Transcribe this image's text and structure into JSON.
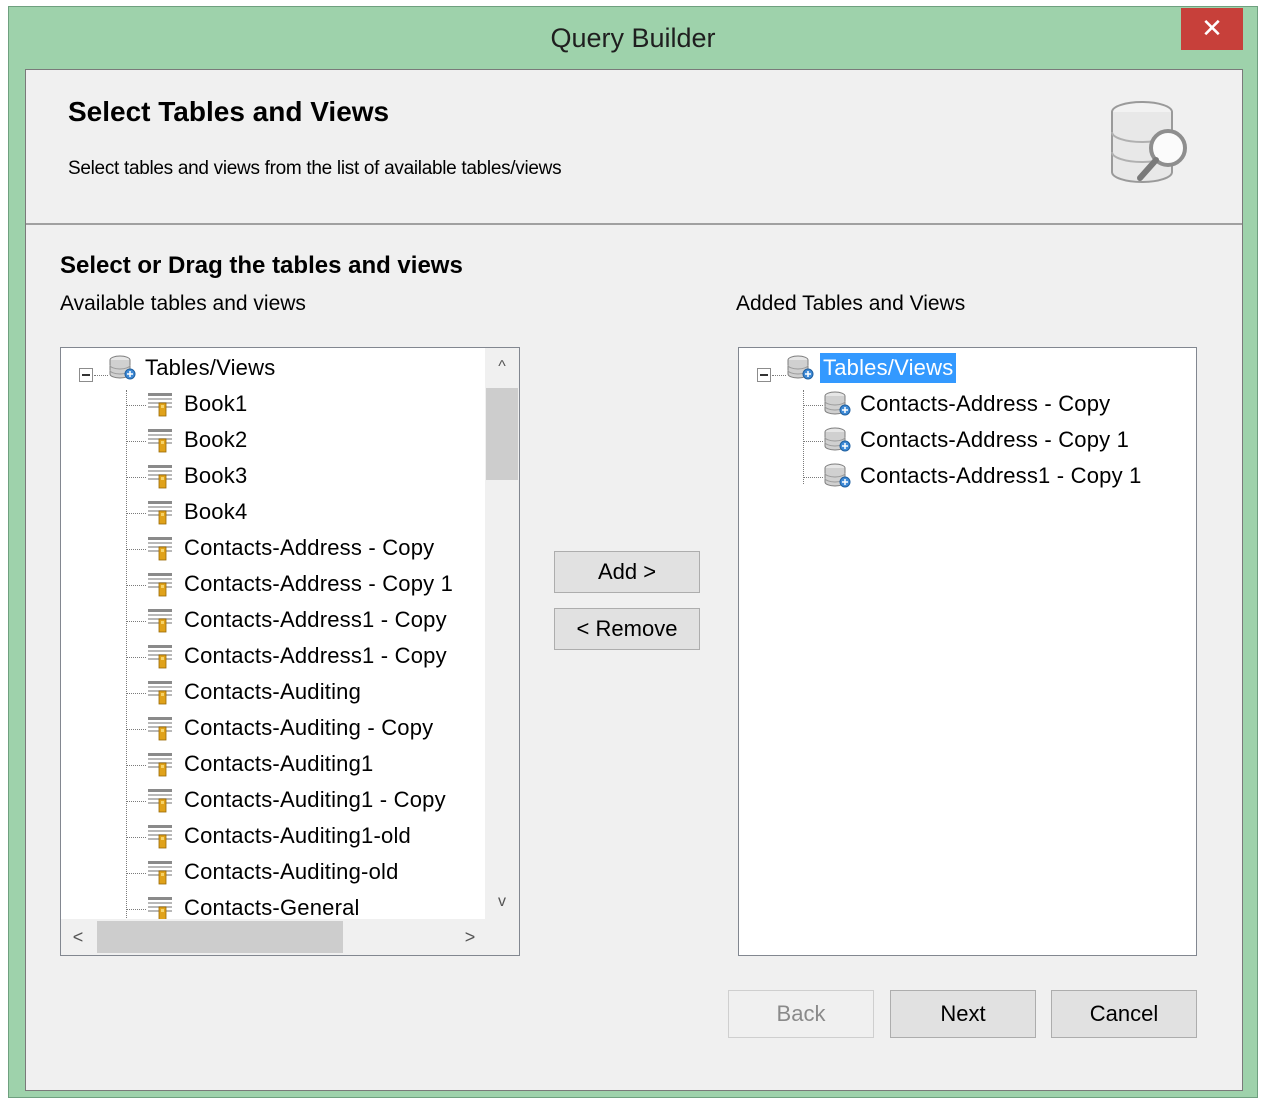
{
  "window": {
    "title": "Query Builder",
    "close_label": "✕"
  },
  "header": {
    "title": "Select Tables and Views",
    "subtitle": "Select tables and views from the list of available tables/views",
    "icon": "database-search-icon"
  },
  "section_title": "Select or Drag the tables and views",
  "available": {
    "label": "Available tables and views",
    "root": "Tables/Views",
    "items": [
      "Book1",
      "Book2",
      "Book3",
      "Book4",
      "Contacts-Address - Copy",
      "Contacts-Address - Copy 1",
      "Contacts-Address1 - Copy",
      "Contacts-Address1 - Copy",
      "Contacts-Auditing",
      "Contacts-Auditing - Copy",
      "Contacts-Auditing1",
      "Contacts-Auditing1 - Copy",
      "Contacts-Auditing1-old",
      "Contacts-Auditing-old",
      "Contacts-General"
    ],
    "scroll": {
      "up": "^",
      "down": "v",
      "left": "<",
      "right": ">"
    }
  },
  "added": {
    "label": "Added Tables and Views",
    "root": "Tables/Views",
    "items": [
      "Contacts-Address - Copy",
      "Contacts-Address - Copy 1",
      "Contacts-Address1 - Copy 1"
    ]
  },
  "buttons": {
    "add": "Add >",
    "remove": "< Remove",
    "back": "Back",
    "next": "Next",
    "cancel": "Cancel"
  },
  "colors": {
    "window_frame": "#9ed2ab",
    "close": "#c7403a",
    "selection": "#3399ff"
  }
}
